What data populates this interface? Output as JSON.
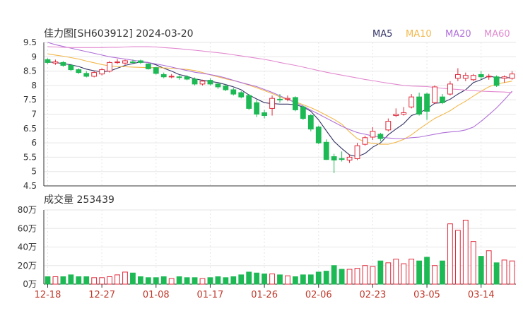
{
  "title": "佳力图[SH603912] 2024-03-20",
  "legend": [
    {
      "label": "MA5",
      "color": "#333366"
    },
    {
      "label": "MA10",
      "color": "#f2b84b"
    },
    {
      "label": "MA20",
      "color": "#b070d8"
    },
    {
      "label": "MA60",
      "color": "#e28ad0"
    }
  ],
  "volume_title": "成交量 253439",
  "colors": {
    "up": "#e02b3c",
    "down": "#1db954",
    "grid": "#e6e6e6",
    "axis": "#333333"
  },
  "chart_data": [
    {
      "type": "candlestick",
      "name": "price",
      "ylim": [
        4.5,
        9.5
      ],
      "yticks": [
        "9.5",
        "9",
        "8.5",
        "8",
        "7.5",
        "7",
        "6.5",
        "6",
        "5.5",
        "5",
        "4.5"
      ],
      "x_tick_labels": [
        "12-18",
        "12-27",
        "01-08",
        "01-17",
        "01-26",
        "02-06",
        "02-23",
        "03-05",
        "03-14"
      ],
      "x_tick_index": [
        0,
        7,
        14,
        21,
        28,
        35,
        42,
        49,
        56
      ],
      "dates": [
        "12-18",
        "12-19",
        "12-20",
        "12-21",
        "12-22",
        "12-25",
        "12-26",
        "12-27",
        "12-28",
        "12-29",
        "01-02",
        "01-03",
        "01-04",
        "01-05",
        "01-08",
        "01-09",
        "01-10",
        "01-11",
        "01-12",
        "01-15",
        "01-16",
        "01-17",
        "01-18",
        "01-19",
        "01-22",
        "01-23",
        "01-24",
        "01-25",
        "01-26",
        "01-29",
        "01-30",
        "01-31",
        "02-01",
        "02-02",
        "02-05",
        "02-06",
        "02-07",
        "02-08",
        "02-19",
        "02-20",
        "02-21",
        "02-22",
        "02-23",
        "02-26",
        "02-27",
        "02-28",
        "02-29",
        "03-01",
        "03-04",
        "03-05",
        "03-06",
        "03-07",
        "03-08",
        "03-11",
        "03-12",
        "03-13",
        "03-14",
        "03-15",
        "03-18",
        "03-19",
        "03-20"
      ],
      "open": [
        8.9,
        8.78,
        8.8,
        8.7,
        8.55,
        8.42,
        8.32,
        8.4,
        8.5,
        8.8,
        8.78,
        8.82,
        8.86,
        8.75,
        8.62,
        8.38,
        8.3,
        8.3,
        8.3,
        8.22,
        8.05,
        8.18,
        8.05,
        7.98,
        7.85,
        7.75,
        7.65,
        7.4,
        7.05,
        7.2,
        7.52,
        7.52,
        7.58,
        7.25,
        6.95,
        6.55,
        6.02,
        5.52,
        5.45,
        5.4,
        5.45,
        5.95,
        6.2,
        6.3,
        6.45,
        6.95,
        7.0,
        7.25,
        7.6,
        7.7,
        7.4,
        7.6,
        7.7,
        8.25,
        8.25,
        8.2,
        8.38,
        8.3,
        8.3,
        8.25,
        8.25
      ],
      "close": [
        8.8,
        8.82,
        8.7,
        8.55,
        8.45,
        8.32,
        8.45,
        8.55,
        8.8,
        8.82,
        8.86,
        8.8,
        8.8,
        8.58,
        8.42,
        8.3,
        8.32,
        8.28,
        8.22,
        8.05,
        8.15,
        8.05,
        7.95,
        7.85,
        7.7,
        7.6,
        7.2,
        7.0,
        6.95,
        7.55,
        7.5,
        7.55,
        7.15,
        6.85,
        6.48,
        6.0,
        5.42,
        5.4,
        5.42,
        5.5,
        5.9,
        6.18,
        6.4,
        6.15,
        6.75,
        7.0,
        7.05,
        7.6,
        7.0,
        7.1,
        7.95,
        7.4,
        8.05,
        8.38,
        8.35,
        8.35,
        8.3,
        8.32,
        8.0,
        8.3,
        8.4
      ],
      "high": [
        8.95,
        8.9,
        8.85,
        8.75,
        8.6,
        8.5,
        8.5,
        8.6,
        8.85,
        8.92,
        8.9,
        8.9,
        8.9,
        8.78,
        8.65,
        8.45,
        8.4,
        8.35,
        8.35,
        8.28,
        8.2,
        8.25,
        8.1,
        8.05,
        7.92,
        7.8,
        7.7,
        7.5,
        7.15,
        7.65,
        7.7,
        7.65,
        7.62,
        7.3,
        7.0,
        6.6,
        6.12,
        5.62,
        5.7,
        5.6,
        6.0,
        6.25,
        6.55,
        6.35,
        6.85,
        7.2,
        7.25,
        7.7,
        7.75,
        7.75,
        8.0,
        7.7,
        8.15,
        8.6,
        8.45,
        8.4,
        8.5,
        8.4,
        8.35,
        8.35,
        8.5
      ],
      "low": [
        8.75,
        8.72,
        8.65,
        8.5,
        8.4,
        8.28,
        8.28,
        8.35,
        8.45,
        8.75,
        8.72,
        8.78,
        8.75,
        8.55,
        8.38,
        8.25,
        8.25,
        8.2,
        8.18,
        8.0,
        8.0,
        8.0,
        7.88,
        7.8,
        7.65,
        7.55,
        7.15,
        6.9,
        6.85,
        6.95,
        7.4,
        7.45,
        7.1,
        6.8,
        6.4,
        5.95,
        5.4,
        4.95,
        5.35,
        5.3,
        5.4,
        5.9,
        6.1,
        6.05,
        6.4,
        6.9,
        6.95,
        7.2,
        6.95,
        6.8,
        7.35,
        7.35,
        7.65,
        8.15,
        8.15,
        8.15,
        8.2,
        8.2,
        7.95,
        8.1,
        8.2
      ],
      "ma": {
        "MA5": [
          8.82,
          8.8,
          8.76,
          8.72,
          8.66,
          8.57,
          8.51,
          8.48,
          8.5,
          8.6,
          8.7,
          8.76,
          8.82,
          8.8,
          8.72,
          8.6,
          8.5,
          8.38,
          8.32,
          8.23,
          8.18,
          8.14,
          8.1,
          8.03,
          7.95,
          7.85,
          7.67,
          7.53,
          7.4,
          7.37,
          7.35,
          7.35,
          7.33,
          7.25,
          7.1,
          6.8,
          6.42,
          6.05,
          5.8,
          5.58,
          5.52,
          5.63,
          5.85,
          6.0,
          6.28,
          6.48,
          6.67,
          6.95,
          7.05,
          7.18,
          7.38,
          7.4,
          7.52,
          7.7,
          7.85,
          8.1,
          8.2,
          8.33,
          8.27,
          8.27,
          8.27
        ],
        "MA10": [
          9.1,
          9.06,
          9.02,
          8.97,
          8.92,
          8.85,
          8.79,
          8.73,
          8.68,
          8.66,
          8.65,
          8.64,
          8.63,
          8.62,
          8.62,
          8.61,
          8.6,
          8.58,
          8.56,
          8.52,
          8.45,
          8.37,
          8.3,
          8.23,
          8.17,
          8.1,
          8.01,
          7.92,
          7.82,
          7.72,
          7.6,
          7.5,
          7.43,
          7.33,
          7.23,
          7.1,
          6.96,
          6.82,
          6.65,
          6.38,
          6.15,
          6.03,
          5.98,
          5.95,
          5.95,
          6.02,
          6.12,
          6.28,
          6.48,
          6.67,
          6.85,
          6.98,
          7.12,
          7.3,
          7.45,
          7.63,
          7.8,
          7.95,
          8.05,
          8.1,
          8.15
        ],
        "MA20": [
          9.5,
          9.42,
          9.36,
          9.3,
          9.24,
          9.18,
          9.12,
          9.06,
          9.0,
          8.96,
          8.92,
          8.88,
          8.84,
          8.8,
          8.75,
          8.7,
          8.64,
          8.58,
          8.52,
          8.46,
          8.42,
          8.38,
          8.33,
          8.26,
          8.18,
          8.1,
          8.03,
          7.96,
          7.86,
          7.76,
          7.64,
          7.52,
          7.4,
          7.28,
          7.14,
          7.0,
          6.86,
          6.72,
          6.58,
          6.46,
          6.36,
          6.3,
          6.24,
          6.2,
          6.17,
          6.15,
          6.15,
          6.18,
          6.2,
          6.25,
          6.3,
          6.35,
          6.38,
          6.4,
          6.45,
          6.55,
          6.75,
          6.98,
          7.22,
          7.5,
          7.8
        ],
        "MA60": [
          9.35,
          9.34,
          9.33,
          9.32,
          9.32,
          9.32,
          9.32,
          9.32,
          9.33,
          9.33,
          9.34,
          9.35,
          9.35,
          9.35,
          9.34,
          9.32,
          9.3,
          9.28,
          9.25,
          9.23,
          9.2,
          9.17,
          9.14,
          9.11,
          9.07,
          9.03,
          8.99,
          8.95,
          8.91,
          8.86,
          8.8,
          8.75,
          8.7,
          8.64,
          8.58,
          8.52,
          8.46,
          8.41,
          8.36,
          8.31,
          8.26,
          8.21,
          8.17,
          8.12,
          8.08,
          8.04,
          8.0,
          7.98,
          7.97,
          7.96,
          7.93,
          7.9,
          7.88,
          7.86,
          7.84,
          7.82,
          7.8,
          7.79,
          7.78,
          7.77,
          7.75
        ]
      }
    },
    {
      "type": "bar",
      "name": "volume",
      "ylim": [
        0,
        80
      ],
      "yticks": [
        "80万",
        "60万",
        "40万",
        "20万",
        "0万"
      ],
      "values": [
        8,
        8,
        8,
        10,
        8,
        8,
        7,
        7,
        8,
        10,
        13,
        12,
        8,
        7,
        7,
        8,
        6,
        8,
        7,
        7,
        6,
        7,
        8,
        7,
        8,
        10,
        13,
        12,
        11,
        11,
        10,
        9,
        8,
        10,
        10,
        13,
        14,
        20,
        16,
        16,
        17,
        20,
        19,
        25,
        23,
        27,
        22,
        27,
        25,
        29,
        20,
        25,
        65,
        58,
        69,
        46,
        30,
        36,
        23,
        26,
        25,
        18,
        20,
        26
      ],
      "up": [
        false,
        true,
        false,
        true,
        false,
        false,
        true,
        true,
        true,
        true,
        true,
        false,
        false,
        false,
        false,
        true,
        false,
        false,
        false,
        false,
        true,
        false,
        false,
        false,
        false,
        false,
        false,
        false,
        true,
        false,
        true,
        false,
        false,
        false,
        false,
        false,
        false,
        true,
        true,
        true,
        true,
        true,
        true,
        true,
        true,
        true,
        true,
        false,
        true,
        false,
        true,
        true,
        true,
        false,
        true,
        false,
        false,
        false,
        true,
        false,
        true,
        true
      ]
    }
  ]
}
